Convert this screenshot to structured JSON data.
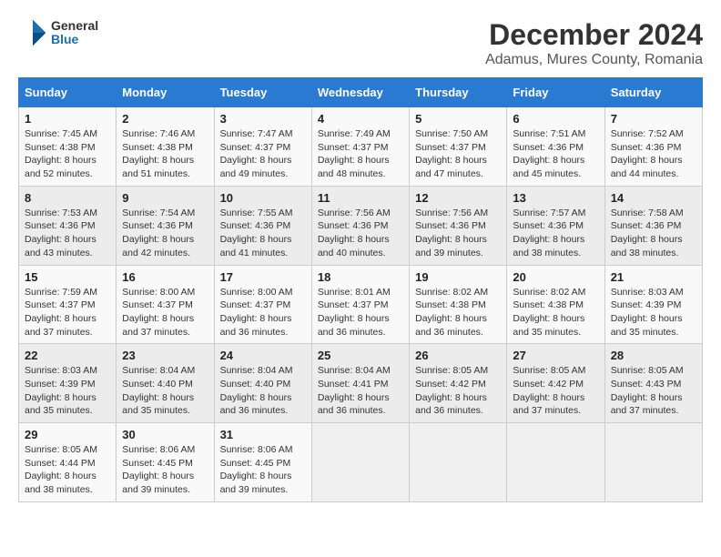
{
  "logo": {
    "general": "General",
    "blue": "Blue"
  },
  "title": "December 2024",
  "subtitle": "Adamus, Mures County, Romania",
  "days_of_week": [
    "Sunday",
    "Monday",
    "Tuesday",
    "Wednesday",
    "Thursday",
    "Friday",
    "Saturday"
  ],
  "weeks": [
    [
      {
        "day": 1,
        "sunrise": "Sunrise: 7:45 AM",
        "sunset": "Sunset: 4:38 PM",
        "daylight": "Daylight: 8 hours and 52 minutes."
      },
      {
        "day": 2,
        "sunrise": "Sunrise: 7:46 AM",
        "sunset": "Sunset: 4:38 PM",
        "daylight": "Daylight: 8 hours and 51 minutes."
      },
      {
        "day": 3,
        "sunrise": "Sunrise: 7:47 AM",
        "sunset": "Sunset: 4:37 PM",
        "daylight": "Daylight: 8 hours and 49 minutes."
      },
      {
        "day": 4,
        "sunrise": "Sunrise: 7:49 AM",
        "sunset": "Sunset: 4:37 PM",
        "daylight": "Daylight: 8 hours and 48 minutes."
      },
      {
        "day": 5,
        "sunrise": "Sunrise: 7:50 AM",
        "sunset": "Sunset: 4:37 PM",
        "daylight": "Daylight: 8 hours and 47 minutes."
      },
      {
        "day": 6,
        "sunrise": "Sunrise: 7:51 AM",
        "sunset": "Sunset: 4:36 PM",
        "daylight": "Daylight: 8 hours and 45 minutes."
      },
      {
        "day": 7,
        "sunrise": "Sunrise: 7:52 AM",
        "sunset": "Sunset: 4:36 PM",
        "daylight": "Daylight: 8 hours and 44 minutes."
      }
    ],
    [
      {
        "day": 8,
        "sunrise": "Sunrise: 7:53 AM",
        "sunset": "Sunset: 4:36 PM",
        "daylight": "Daylight: 8 hours and 43 minutes."
      },
      {
        "day": 9,
        "sunrise": "Sunrise: 7:54 AM",
        "sunset": "Sunset: 4:36 PM",
        "daylight": "Daylight: 8 hours and 42 minutes."
      },
      {
        "day": 10,
        "sunrise": "Sunrise: 7:55 AM",
        "sunset": "Sunset: 4:36 PM",
        "daylight": "Daylight: 8 hours and 41 minutes."
      },
      {
        "day": 11,
        "sunrise": "Sunrise: 7:56 AM",
        "sunset": "Sunset: 4:36 PM",
        "daylight": "Daylight: 8 hours and 40 minutes."
      },
      {
        "day": 12,
        "sunrise": "Sunrise: 7:56 AM",
        "sunset": "Sunset: 4:36 PM",
        "daylight": "Daylight: 8 hours and 39 minutes."
      },
      {
        "day": 13,
        "sunrise": "Sunrise: 7:57 AM",
        "sunset": "Sunset: 4:36 PM",
        "daylight": "Daylight: 8 hours and 38 minutes."
      },
      {
        "day": 14,
        "sunrise": "Sunrise: 7:58 AM",
        "sunset": "Sunset: 4:36 PM",
        "daylight": "Daylight: 8 hours and 38 minutes."
      }
    ],
    [
      {
        "day": 15,
        "sunrise": "Sunrise: 7:59 AM",
        "sunset": "Sunset: 4:37 PM",
        "daylight": "Daylight: 8 hours and 37 minutes."
      },
      {
        "day": 16,
        "sunrise": "Sunrise: 8:00 AM",
        "sunset": "Sunset: 4:37 PM",
        "daylight": "Daylight: 8 hours and 37 minutes."
      },
      {
        "day": 17,
        "sunrise": "Sunrise: 8:00 AM",
        "sunset": "Sunset: 4:37 PM",
        "daylight": "Daylight: 8 hours and 36 minutes."
      },
      {
        "day": 18,
        "sunrise": "Sunrise: 8:01 AM",
        "sunset": "Sunset: 4:37 PM",
        "daylight": "Daylight: 8 hours and 36 minutes."
      },
      {
        "day": 19,
        "sunrise": "Sunrise: 8:02 AM",
        "sunset": "Sunset: 4:38 PM",
        "daylight": "Daylight: 8 hours and 36 minutes."
      },
      {
        "day": 20,
        "sunrise": "Sunrise: 8:02 AM",
        "sunset": "Sunset: 4:38 PM",
        "daylight": "Daylight: 8 hours and 35 minutes."
      },
      {
        "day": 21,
        "sunrise": "Sunrise: 8:03 AM",
        "sunset": "Sunset: 4:39 PM",
        "daylight": "Daylight: 8 hours and 35 minutes."
      }
    ],
    [
      {
        "day": 22,
        "sunrise": "Sunrise: 8:03 AM",
        "sunset": "Sunset: 4:39 PM",
        "daylight": "Daylight: 8 hours and 35 minutes."
      },
      {
        "day": 23,
        "sunrise": "Sunrise: 8:04 AM",
        "sunset": "Sunset: 4:40 PM",
        "daylight": "Daylight: 8 hours and 35 minutes."
      },
      {
        "day": 24,
        "sunrise": "Sunrise: 8:04 AM",
        "sunset": "Sunset: 4:40 PM",
        "daylight": "Daylight: 8 hours and 36 minutes."
      },
      {
        "day": 25,
        "sunrise": "Sunrise: 8:04 AM",
        "sunset": "Sunset: 4:41 PM",
        "daylight": "Daylight: 8 hours and 36 minutes."
      },
      {
        "day": 26,
        "sunrise": "Sunrise: 8:05 AM",
        "sunset": "Sunset: 4:42 PM",
        "daylight": "Daylight: 8 hours and 36 minutes."
      },
      {
        "day": 27,
        "sunrise": "Sunrise: 8:05 AM",
        "sunset": "Sunset: 4:42 PM",
        "daylight": "Daylight: 8 hours and 37 minutes."
      },
      {
        "day": 28,
        "sunrise": "Sunrise: 8:05 AM",
        "sunset": "Sunset: 4:43 PM",
        "daylight": "Daylight: 8 hours and 37 minutes."
      }
    ],
    [
      {
        "day": 29,
        "sunrise": "Sunrise: 8:05 AM",
        "sunset": "Sunset: 4:44 PM",
        "daylight": "Daylight: 8 hours and 38 minutes."
      },
      {
        "day": 30,
        "sunrise": "Sunrise: 8:06 AM",
        "sunset": "Sunset: 4:45 PM",
        "daylight": "Daylight: 8 hours and 39 minutes."
      },
      {
        "day": 31,
        "sunrise": "Sunrise: 8:06 AM",
        "sunset": "Sunset: 4:45 PM",
        "daylight": "Daylight: 8 hours and 39 minutes."
      },
      null,
      null,
      null,
      null
    ]
  ]
}
